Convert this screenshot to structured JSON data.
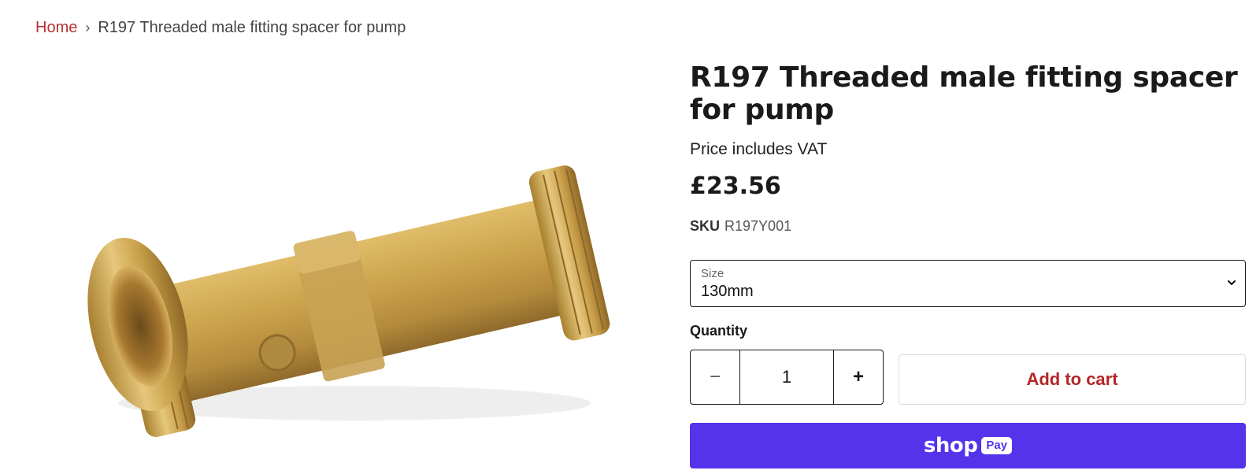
{
  "breadcrumb": {
    "home": "Home",
    "separator": "›",
    "current": "R197 Threaded male fitting spacer for pump"
  },
  "product": {
    "title": "R197 Threaded male fitting spacer for pump",
    "vat_note": "Price includes VAT",
    "price": "£23.56",
    "sku_label": "SKU",
    "sku_value": "R197Y001",
    "image_alt": "brass-threaded-spacer-photo"
  },
  "size_select": {
    "label": "Size",
    "value": "130mm",
    "icon": "chevron-down-icon"
  },
  "quantity": {
    "label": "Quantity",
    "minus": "−",
    "value": "1",
    "plus": "+"
  },
  "actions": {
    "add_to_cart": "Add to cart",
    "shop_pay_word": "shop",
    "shop_pay_badge": "Pay"
  },
  "colors": {
    "accent_red": "#b32727",
    "shop_pay_purple": "#5433eb",
    "brass": "#c9a254"
  }
}
